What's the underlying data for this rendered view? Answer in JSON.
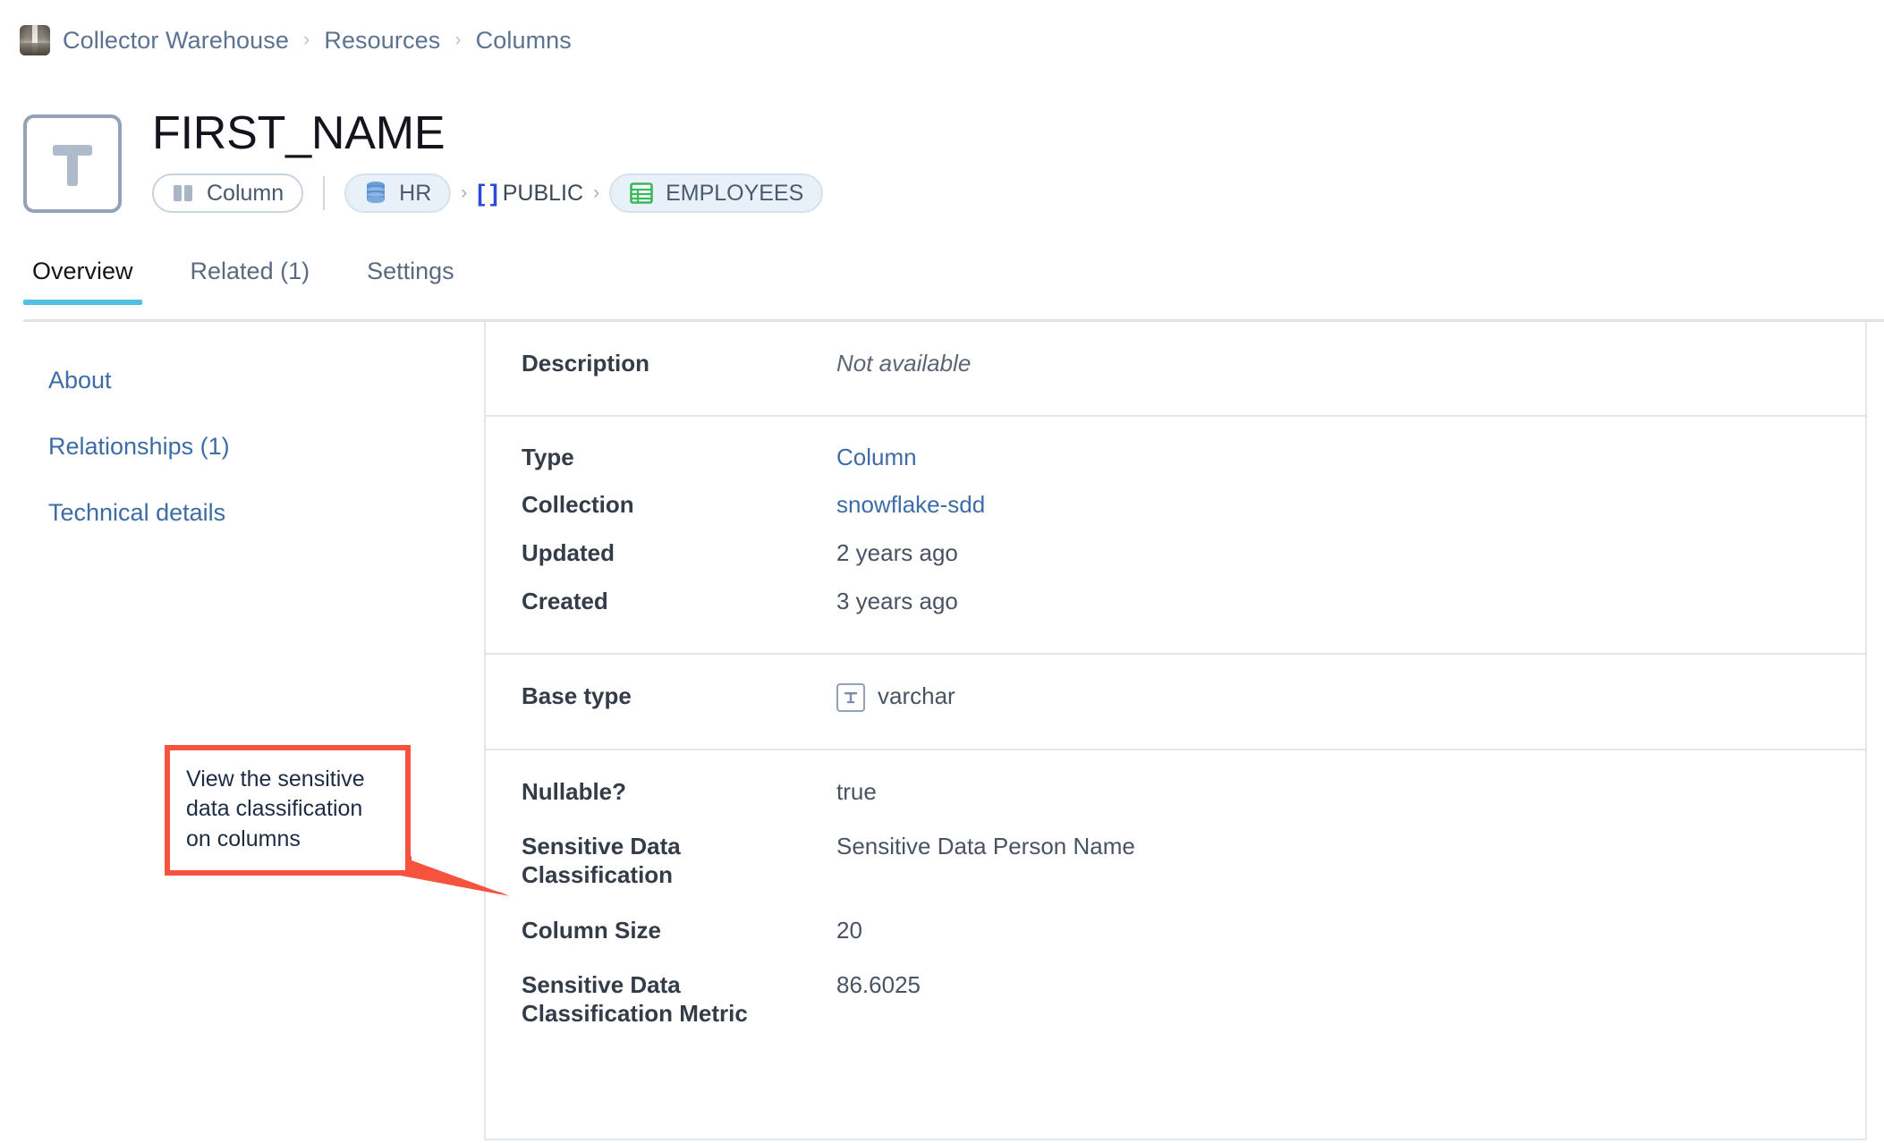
{
  "breadcrumb": {
    "thumbnail_icon": "warehouse-thumbnail",
    "items": [
      "Collector Warehouse",
      "Resources",
      "Columns"
    ],
    "separator": "›"
  },
  "header": {
    "icon": "text-type-icon",
    "title": "FIRST_NAME",
    "badges": {
      "type_pill": {
        "label": "Column",
        "icon": "columns-icon"
      },
      "database_pill": {
        "label": "HR",
        "icon": "database-icon"
      },
      "schema_node": {
        "label": "PUBLIC",
        "icon": "brackets-icon"
      },
      "table_pill": {
        "label": "EMPLOYEES",
        "icon": "table-grid-icon"
      }
    },
    "path_separator": "›"
  },
  "tabs": [
    {
      "label": "Overview",
      "active": true
    },
    {
      "label": "Related (1)",
      "active": false
    },
    {
      "label": "Settings",
      "active": false
    }
  ],
  "sidebar": {
    "items": [
      {
        "label": "About"
      },
      {
        "label": "Relationships (1)"
      },
      {
        "label": "Technical details"
      }
    ]
  },
  "details": {
    "groups": [
      {
        "rows": [
          {
            "label": "Description",
            "value": "Not available",
            "style": "muted"
          }
        ]
      },
      {
        "rows": [
          {
            "label": "Type",
            "value": "Column",
            "style": "link"
          },
          {
            "label": "Collection",
            "value": "snowflake-sdd",
            "style": "link"
          },
          {
            "label": "Updated",
            "value": "2 years ago",
            "style": "plain"
          },
          {
            "label": "Created",
            "value": "3 years ago",
            "style": "plain"
          }
        ]
      },
      {
        "rows": [
          {
            "label": "Base type",
            "value": "varchar",
            "style": "icon",
            "icon": "text-type-icon"
          }
        ]
      },
      {
        "rows": [
          {
            "label": "Nullable?",
            "value": "true",
            "style": "plain"
          },
          {
            "label": "Sensitive Data Classification",
            "value": "Sensitive Data Person Name",
            "style": "plain"
          },
          {
            "label": "Column Size",
            "value": "20",
            "style": "plain"
          },
          {
            "label": "Sensitive Data Classification Metric",
            "value": "86.6025",
            "style": "plain"
          }
        ]
      }
    ]
  },
  "annotation": {
    "text": "View the sensitive\ndata classification\non columns",
    "color": "#f5533e",
    "points_at": "Sensitive Data Classification"
  },
  "colors": {
    "accent_tab": "#4fc0e0",
    "link": "#3d6ca6",
    "annotation": "#f5533e",
    "panel_border": "#e4e7ea",
    "brackets_blue": "#2a4ad7",
    "table_icon_green": "#38b95b"
  }
}
